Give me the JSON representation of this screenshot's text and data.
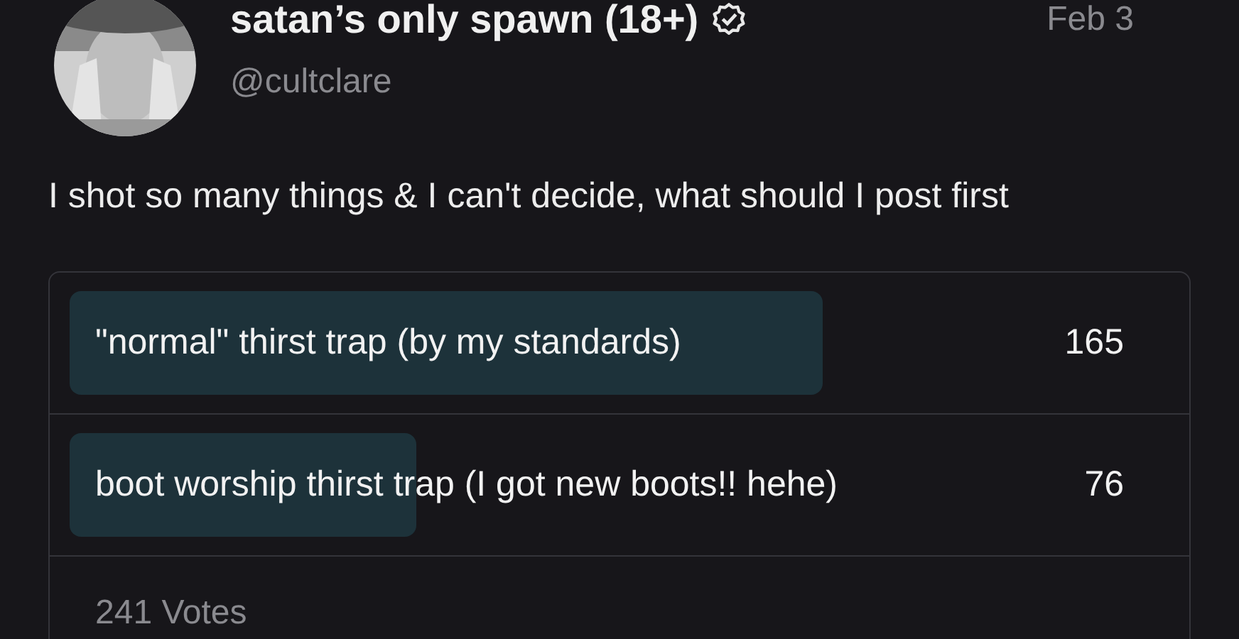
{
  "post": {
    "author": {
      "name": "satan’s only spawn (18+)",
      "verified": true,
      "handle": "@cultclare"
    },
    "date": "Feb 3",
    "text": "I shot so many things & I can't decide, what should I post first"
  },
  "poll": {
    "options": [
      {
        "label": "\"normal\" thirst trap (by my standards)",
        "count": "165",
        "level": 0.685
      },
      {
        "label": "boot worship thirst trap (I got new boots!! hehe)",
        "count": "76",
        "level": 0.315
      }
    ],
    "total": "241 Votes"
  }
}
